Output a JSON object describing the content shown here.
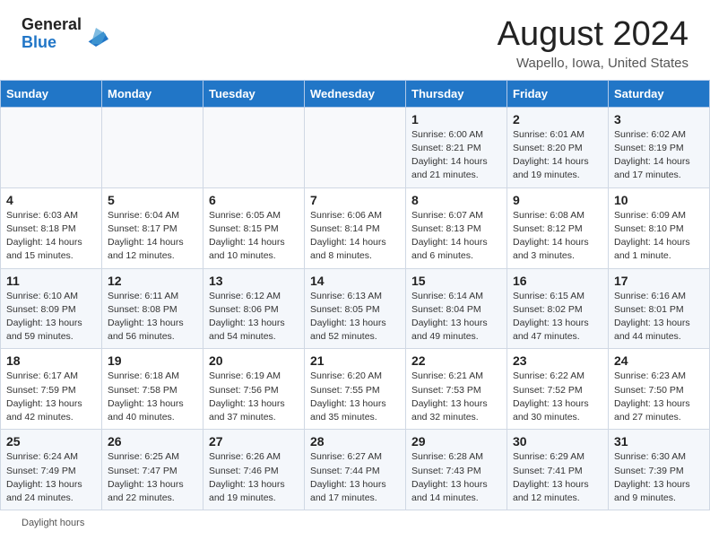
{
  "header": {
    "logo_general": "General",
    "logo_blue": "Blue",
    "month_title": "August 2024",
    "location": "Wapello, Iowa, United States"
  },
  "days_of_week": [
    "Sunday",
    "Monday",
    "Tuesday",
    "Wednesday",
    "Thursday",
    "Friday",
    "Saturday"
  ],
  "weeks": [
    [
      {
        "day": "",
        "info": ""
      },
      {
        "day": "",
        "info": ""
      },
      {
        "day": "",
        "info": ""
      },
      {
        "day": "",
        "info": ""
      },
      {
        "day": "1",
        "info": "Sunrise: 6:00 AM\nSunset: 8:21 PM\nDaylight: 14 hours\nand 21 minutes."
      },
      {
        "day": "2",
        "info": "Sunrise: 6:01 AM\nSunset: 8:20 PM\nDaylight: 14 hours\nand 19 minutes."
      },
      {
        "day": "3",
        "info": "Sunrise: 6:02 AM\nSunset: 8:19 PM\nDaylight: 14 hours\nand 17 minutes."
      }
    ],
    [
      {
        "day": "4",
        "info": "Sunrise: 6:03 AM\nSunset: 8:18 PM\nDaylight: 14 hours\nand 15 minutes."
      },
      {
        "day": "5",
        "info": "Sunrise: 6:04 AM\nSunset: 8:17 PM\nDaylight: 14 hours\nand 12 minutes."
      },
      {
        "day": "6",
        "info": "Sunrise: 6:05 AM\nSunset: 8:15 PM\nDaylight: 14 hours\nand 10 minutes."
      },
      {
        "day": "7",
        "info": "Sunrise: 6:06 AM\nSunset: 8:14 PM\nDaylight: 14 hours\nand 8 minutes."
      },
      {
        "day": "8",
        "info": "Sunrise: 6:07 AM\nSunset: 8:13 PM\nDaylight: 14 hours\nand 6 minutes."
      },
      {
        "day": "9",
        "info": "Sunrise: 6:08 AM\nSunset: 8:12 PM\nDaylight: 14 hours\nand 3 minutes."
      },
      {
        "day": "10",
        "info": "Sunrise: 6:09 AM\nSunset: 8:10 PM\nDaylight: 14 hours\nand 1 minute."
      }
    ],
    [
      {
        "day": "11",
        "info": "Sunrise: 6:10 AM\nSunset: 8:09 PM\nDaylight: 13 hours\nand 59 minutes."
      },
      {
        "day": "12",
        "info": "Sunrise: 6:11 AM\nSunset: 8:08 PM\nDaylight: 13 hours\nand 56 minutes."
      },
      {
        "day": "13",
        "info": "Sunrise: 6:12 AM\nSunset: 8:06 PM\nDaylight: 13 hours\nand 54 minutes."
      },
      {
        "day": "14",
        "info": "Sunrise: 6:13 AM\nSunset: 8:05 PM\nDaylight: 13 hours\nand 52 minutes."
      },
      {
        "day": "15",
        "info": "Sunrise: 6:14 AM\nSunset: 8:04 PM\nDaylight: 13 hours\nand 49 minutes."
      },
      {
        "day": "16",
        "info": "Sunrise: 6:15 AM\nSunset: 8:02 PM\nDaylight: 13 hours\nand 47 minutes."
      },
      {
        "day": "17",
        "info": "Sunrise: 6:16 AM\nSunset: 8:01 PM\nDaylight: 13 hours\nand 44 minutes."
      }
    ],
    [
      {
        "day": "18",
        "info": "Sunrise: 6:17 AM\nSunset: 7:59 PM\nDaylight: 13 hours\nand 42 minutes."
      },
      {
        "day": "19",
        "info": "Sunrise: 6:18 AM\nSunset: 7:58 PM\nDaylight: 13 hours\nand 40 minutes."
      },
      {
        "day": "20",
        "info": "Sunrise: 6:19 AM\nSunset: 7:56 PM\nDaylight: 13 hours\nand 37 minutes."
      },
      {
        "day": "21",
        "info": "Sunrise: 6:20 AM\nSunset: 7:55 PM\nDaylight: 13 hours\nand 35 minutes."
      },
      {
        "day": "22",
        "info": "Sunrise: 6:21 AM\nSunset: 7:53 PM\nDaylight: 13 hours\nand 32 minutes."
      },
      {
        "day": "23",
        "info": "Sunrise: 6:22 AM\nSunset: 7:52 PM\nDaylight: 13 hours\nand 30 minutes."
      },
      {
        "day": "24",
        "info": "Sunrise: 6:23 AM\nSunset: 7:50 PM\nDaylight: 13 hours\nand 27 minutes."
      }
    ],
    [
      {
        "day": "25",
        "info": "Sunrise: 6:24 AM\nSunset: 7:49 PM\nDaylight: 13 hours\nand 24 minutes."
      },
      {
        "day": "26",
        "info": "Sunrise: 6:25 AM\nSunset: 7:47 PM\nDaylight: 13 hours\nand 22 minutes."
      },
      {
        "day": "27",
        "info": "Sunrise: 6:26 AM\nSunset: 7:46 PM\nDaylight: 13 hours\nand 19 minutes."
      },
      {
        "day": "28",
        "info": "Sunrise: 6:27 AM\nSunset: 7:44 PM\nDaylight: 13 hours\nand 17 minutes."
      },
      {
        "day": "29",
        "info": "Sunrise: 6:28 AM\nSunset: 7:43 PM\nDaylight: 13 hours\nand 14 minutes."
      },
      {
        "day": "30",
        "info": "Sunrise: 6:29 AM\nSunset: 7:41 PM\nDaylight: 13 hours\nand 12 minutes."
      },
      {
        "day": "31",
        "info": "Sunrise: 6:30 AM\nSunset: 7:39 PM\nDaylight: 13 hours\nand 9 minutes."
      }
    ]
  ],
  "footer": {
    "note": "Daylight hours"
  }
}
